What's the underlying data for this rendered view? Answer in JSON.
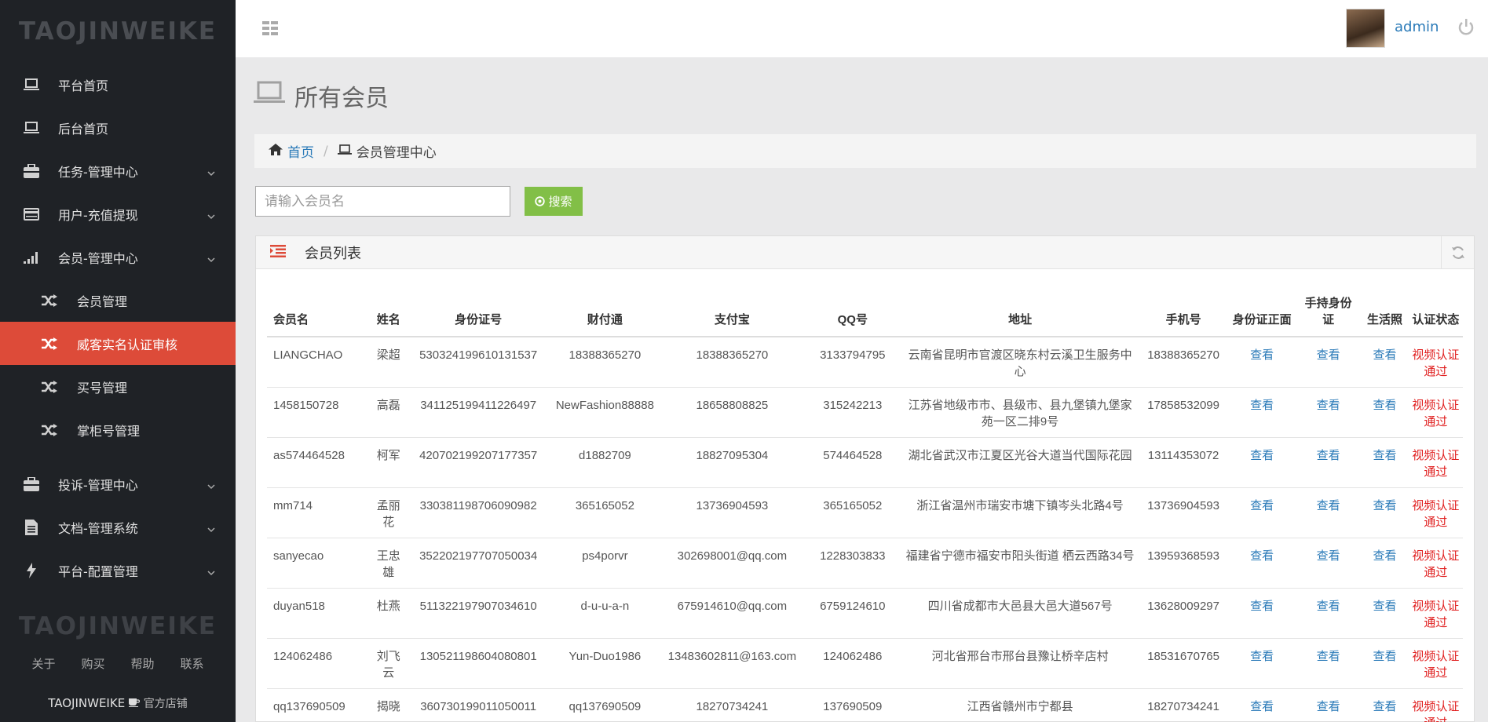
{
  "brand": "TAOJINWEIKE",
  "sidebar": {
    "items": [
      {
        "label": "平台首页"
      },
      {
        "label": "后台首页"
      },
      {
        "label": "任务-管理中心"
      },
      {
        "label": "用户-充值提现"
      },
      {
        "label": "会员-管理中心"
      }
    ],
    "subitems": [
      {
        "label": "会员管理"
      },
      {
        "label": "威客实名认证审核"
      },
      {
        "label": "买号管理"
      },
      {
        "label": "掌柜号管理"
      }
    ],
    "items2": [
      {
        "label": "投诉-管理中心"
      },
      {
        "label": "文档-管理系统"
      },
      {
        "label": "平台-配置管理"
      }
    ],
    "footer_brand": "TAOJINWEIKE",
    "footer_links": [
      "关于",
      "购买",
      "帮助",
      "联系"
    ],
    "shop_brand": "TAOJINWEIKE",
    "shop_label": "官方店铺"
  },
  "header": {
    "user": "admin"
  },
  "page": {
    "title": "所有会员"
  },
  "breadcrumb": {
    "home": "首页",
    "current": "会员管理中心"
  },
  "search": {
    "placeholder": "请输入会员名",
    "button": "搜索"
  },
  "panel": {
    "title": "会员列表"
  },
  "table": {
    "headers": [
      "会员名",
      "姓名",
      "身份证号",
      "财付通",
      "支付宝",
      "QQ号",
      "地址",
      "手机号",
      "身份证正面",
      "手持身份证",
      "生活照",
      "认证状态"
    ],
    "view_label": "查看",
    "rows": [
      {
        "username": "LIANGCHAO",
        "name": "梁超",
        "id": "530324199610131537",
        "tenpay": "18388365270",
        "alipay": "18388365270",
        "qq": "3133794795",
        "address": "云南省昆明市官渡区晓东村云溪卫生服务中心",
        "phone": "18388365270",
        "status": "视频认证通过"
      },
      {
        "username": "1458150728",
        "name": "高磊",
        "id": "341125199411226497",
        "tenpay": "NewFashion88888",
        "alipay": "18658808825",
        "qq": "315242213",
        "address": "江苏省地级市市、县级市、县九堡镇九堡家苑一区二排9号",
        "phone": "17858532099",
        "status": "视频认证通过"
      },
      {
        "username": "as574464528",
        "name": "柯军",
        "id": "420702199207177357",
        "tenpay": "d1882709",
        "alipay": "18827095304",
        "qq": "574464528",
        "address": "湖北省武汉市江夏区光谷大道当代国际花园",
        "phone": "13114353072",
        "status": "视频认证通过"
      },
      {
        "username": "mm714",
        "name": "孟丽花",
        "id": "330381198706090982",
        "tenpay": "365165052",
        "alipay": "13736904593",
        "qq": "365165052",
        "address": "浙江省温州市瑞安市塘下镇岑头北路4号",
        "phone": "13736904593",
        "status": "视频认证通过"
      },
      {
        "username": "sanyecao",
        "name": "王忠雄",
        "id": "352202197707050034",
        "tenpay": "ps4porvr",
        "alipay": "302698001@qq.com",
        "qq": "1228303833",
        "address": "福建省宁德市福安市阳头街道 栖云西路34号",
        "phone": "13959368593",
        "status": "视频认证通过"
      },
      {
        "username": "duyan518",
        "name": "杜燕",
        "id": "511322197907034610",
        "tenpay": "d-u-u-a-n",
        "alipay": "675914610@qq.com",
        "qq": "6759124610",
        "address": "四川省成都市大邑县大邑大道567号",
        "phone": "13628009297",
        "status": "视频认证通过"
      },
      {
        "username": "124062486",
        "name": "刘飞云",
        "id": "130521198604080801",
        "tenpay": "Yun-Duo1986",
        "alipay": "13483602811@163.com",
        "qq": "124062486",
        "address": "河北省邢台市邢台县豫让桥辛店村",
        "phone": "18531670765",
        "status": "视频认证通过"
      },
      {
        "username": "qq137690509",
        "name": "揭晓",
        "id": "360730199011050011",
        "tenpay": "qq137690509",
        "alipay": "18270734241",
        "qq": "137690509",
        "address": "江西省赣州市宁都县",
        "phone": "18270734241",
        "status": "视频认证通过"
      }
    ]
  }
}
